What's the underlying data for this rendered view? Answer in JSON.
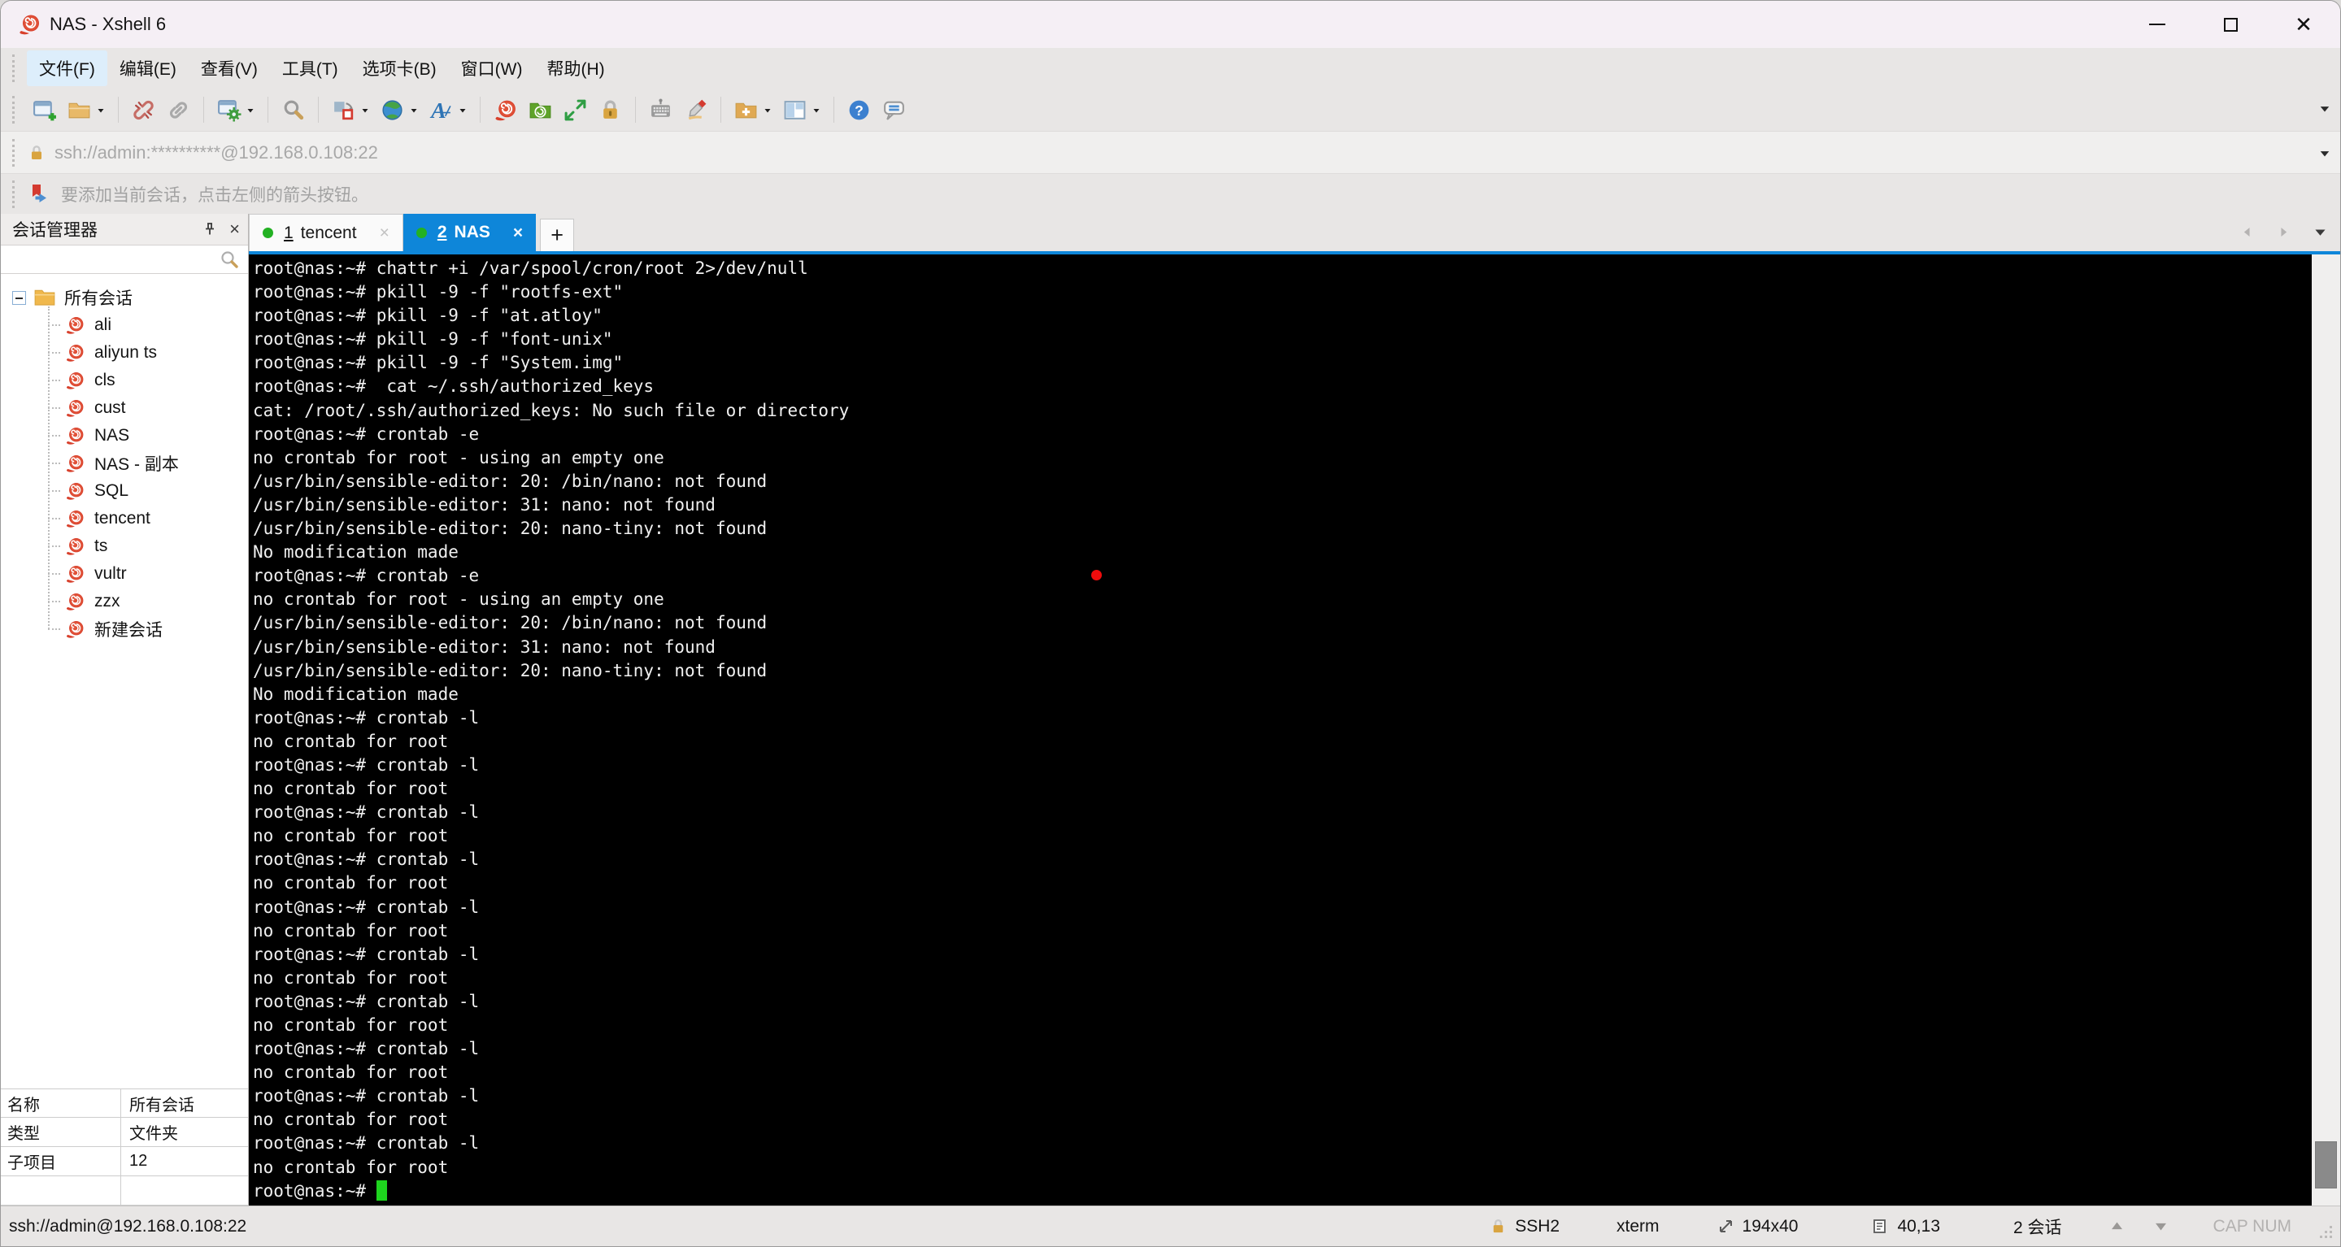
{
  "window": {
    "title": "NAS - Xshell 6",
    "app_icon": "xshell-snail-icon"
  },
  "menubar": {
    "items": [
      {
        "label": "文件(F)",
        "active": true
      },
      {
        "label": "编辑(E)",
        "active": false
      },
      {
        "label": "查看(V)",
        "active": false
      },
      {
        "label": "工具(T)",
        "active": false
      },
      {
        "label": "选项卡(B)",
        "active": false
      },
      {
        "label": "窗口(W)",
        "active": false
      },
      {
        "label": "帮助(H)",
        "active": false
      }
    ]
  },
  "toolbar": {
    "items": [
      {
        "icon": "new-session-icon"
      },
      {
        "icon": "open-folder-icon",
        "dropdown": true
      },
      {
        "separator": true
      },
      {
        "icon": "disconnect-icon"
      },
      {
        "icon": "reconnect-icon"
      },
      {
        "separator": true
      },
      {
        "icon": "session-properties-icon",
        "dropdown": true
      },
      {
        "separator": true
      },
      {
        "icon": "find-icon"
      },
      {
        "separator": true
      },
      {
        "icon": "new-layout-icon",
        "dropdown": true
      },
      {
        "icon": "web-browser-icon",
        "dropdown": true
      },
      {
        "icon": "font-icon",
        "dropdown": true
      },
      {
        "separator": true
      },
      {
        "icon": "xshell-snail-icon"
      },
      {
        "icon": "xftp-icon"
      },
      {
        "icon": "fullscreen-icon"
      },
      {
        "icon": "lock-screen-icon"
      },
      {
        "separator": true
      },
      {
        "icon": "virtual-keyboard-icon"
      },
      {
        "icon": "highlight-pen-icon"
      },
      {
        "separator": true
      },
      {
        "icon": "new-folder-icon",
        "dropdown": true
      },
      {
        "icon": "split-layout-icon",
        "dropdown": true
      },
      {
        "separator": true
      },
      {
        "icon": "help-icon"
      },
      {
        "icon": "feedback-icon"
      }
    ],
    "overflow_icon": "chevron-down-icon"
  },
  "addressbar": {
    "lock_icon": "lock-icon",
    "url": "ssh://admin:**********@192.168.0.108:22",
    "overflow_icon": "chevron-down-icon"
  },
  "infobar": {
    "flag_icon": "flag-icon",
    "text": "要添加当前会话，点击左侧的箭头按钮。"
  },
  "tabbar": {
    "tabs": [
      {
        "number": "1",
        "label": "tencent",
        "active": false,
        "dot_color": "#23b123",
        "close_label": "×"
      },
      {
        "number": "2",
        "label": "NAS",
        "active": true,
        "dot_color": "#23b123",
        "close_label": "×"
      }
    ],
    "new_tab_label": "+",
    "nav_icons": [
      "tab-scroll-left-icon",
      "tab-scroll-right-icon",
      "tab-list-icon"
    ]
  },
  "sidebar": {
    "title": "会话管理器",
    "pin_icon": "pin-icon",
    "close_icon": "close-icon",
    "search_icon": "search-icon",
    "tree": {
      "root_label": "所有会话",
      "root_icon": "folder-icon",
      "session_icon": "session-snail-icon",
      "sessions": [
        "ali",
        "aliyun ts",
        "cls",
        "cust",
        "NAS",
        "NAS - 副本",
        "SQL",
        "tencent",
        "ts",
        "vultr",
        "zzx",
        "新建会话"
      ]
    },
    "properties": [
      {
        "key": "名称",
        "value": "所有会话"
      },
      {
        "key": "类型",
        "value": "文件夹"
      },
      {
        "key": "子项目",
        "value": "12"
      }
    ]
  },
  "terminal": {
    "bg_color": "#000000",
    "text_color": "#f0f0f0",
    "cursor_color": "#1ed41e",
    "lines": [
      "root@nas:~# chattr +i /var/spool/cron/root 2>/dev/null",
      "root@nas:~# pkill -9 -f \"rootfs-ext\"",
      "root@nas:~# pkill -9 -f \"at.atloy\"",
      "root@nas:~# pkill -9 -f \"font-unix\"",
      "root@nas:~# pkill -9 -f \"System.img\"",
      "root@nas:~#  cat ~/.ssh/authorized_keys",
      "cat: /root/.ssh/authorized_keys: No such file or directory",
      "root@nas:~# crontab -e",
      "no crontab for root - using an empty one",
      "/usr/bin/sensible-editor: 20: /bin/nano: not found",
      "/usr/bin/sensible-editor: 31: nano: not found",
      "/usr/bin/sensible-editor: 20: nano-tiny: not found",
      "No modification made",
      "root@nas:~# crontab -e",
      "no crontab for root - using an empty one",
      "/usr/bin/sensible-editor: 20: /bin/nano: not found",
      "/usr/bin/sensible-editor: 31: nano: not found",
      "/usr/bin/sensible-editor: 20: nano-tiny: not found",
      "No modification made",
      "root@nas:~# crontab -l",
      "no crontab for root",
      "root@nas:~# crontab -l",
      "no crontab for root",
      "root@nas:~# crontab -l",
      "no crontab for root",
      "root@nas:~# crontab -l",
      "no crontab for root",
      "root@nas:~# crontab -l",
      "no crontab for root",
      "root@nas:~# crontab -l",
      "no crontab for root",
      "root@nas:~# crontab -l",
      "no crontab for root",
      "root@nas:~# crontab -l",
      "no crontab for root",
      "root@nas:~# crontab -l",
      "no crontab for root",
      "root@nas:~# crontab -l",
      "no crontab for root"
    ],
    "prompt": "root@nas:~# "
  },
  "statusbar": {
    "left": "ssh://admin@192.168.0.108:22",
    "segments": [
      {
        "icon": "lock-icon",
        "text": "SSH2"
      },
      {
        "text": "xterm"
      },
      {
        "icon": "terminal-size-icon",
        "text": "194x40"
      },
      {
        "icon": "cursor-position-icon",
        "text": "40,13"
      },
      {
        "text": "2 会话"
      },
      {
        "icon": "scroll-up-icon",
        "text": ""
      },
      {
        "icon": "scroll-down-icon",
        "text": ""
      },
      {
        "text": "CAP NUM",
        "disabled": true
      }
    ]
  }
}
